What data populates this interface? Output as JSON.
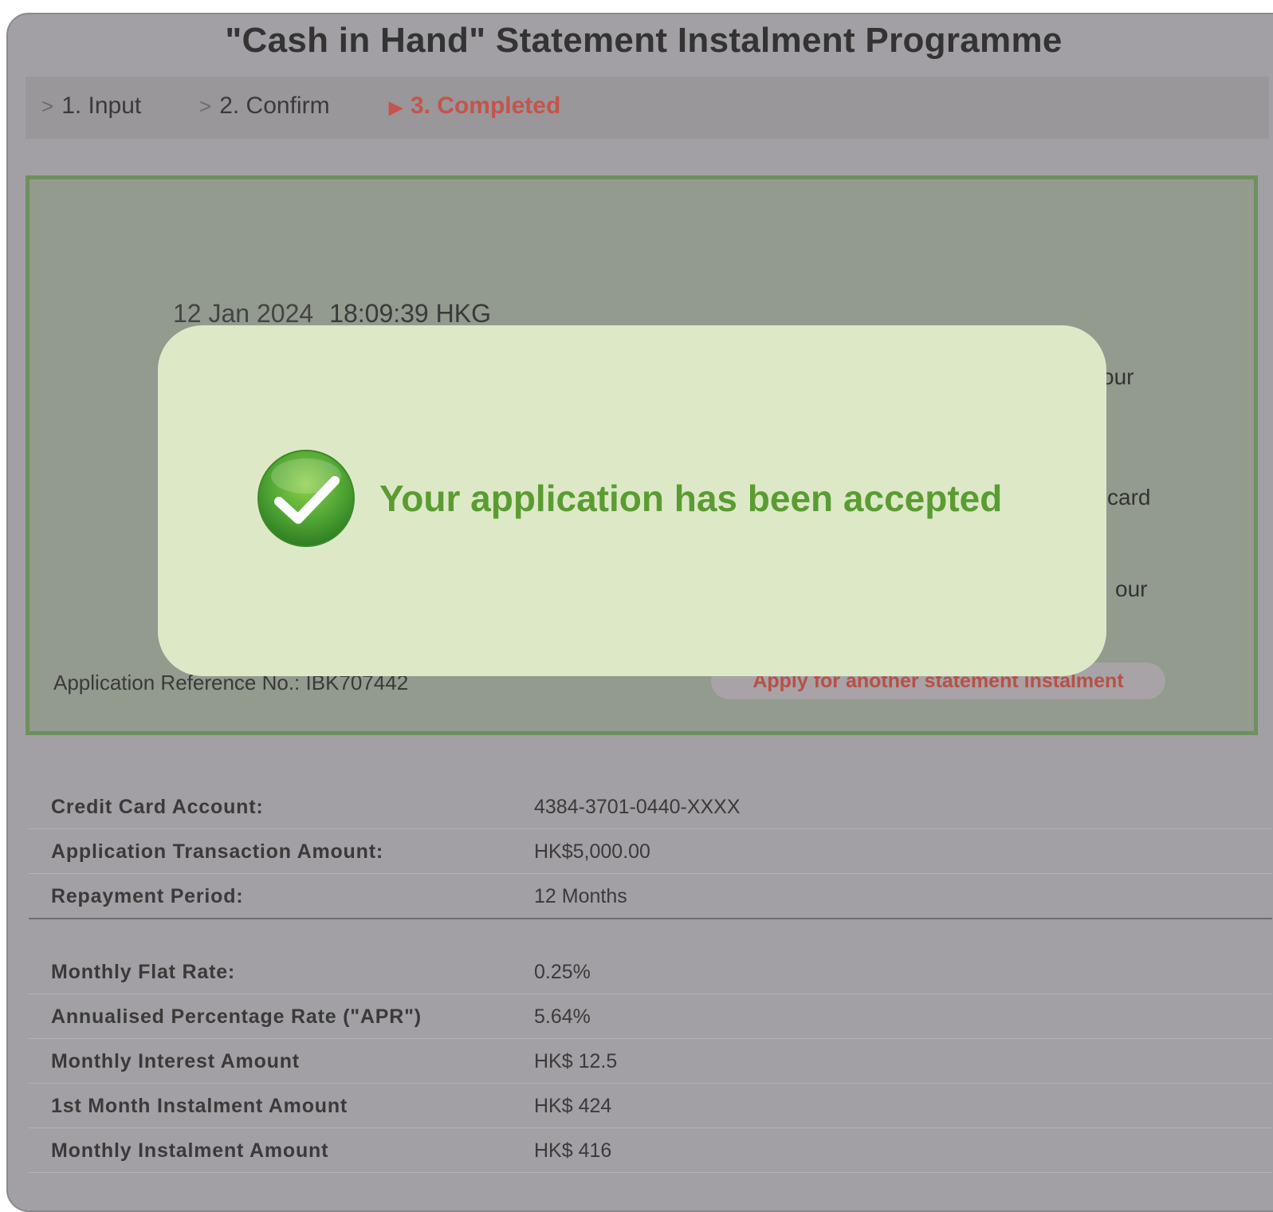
{
  "page": {
    "title": "\"Cash in Hand\" Statement Instalment Programme"
  },
  "steps": [
    {
      "label": "1. Input",
      "active": false
    },
    {
      "label": "2. Confirm",
      "active": false
    },
    {
      "label": "3. Completed",
      "active": true
    }
  ],
  "result": {
    "date": "12 Jan 2024",
    "time": "18:09:39 HKG",
    "peek_1": "our",
    "peek_2": "card",
    "peek_3": "our",
    "reference_text": "Application Reference No.: IBK707442",
    "apply_again_label": "Apply for another statement instalment"
  },
  "modal": {
    "message": "Your application has been accepted",
    "icon": "checkmark-circle-icon"
  },
  "details": {
    "group1": [
      {
        "label": "Credit Card Account:",
        "value": "4384-3701-0440-XXXX"
      },
      {
        "label": "Application Transaction Amount:",
        "value": "HK$5,000.00"
      },
      {
        "label": "Repayment Period:",
        "value": "12 Months"
      }
    ],
    "group2": [
      {
        "label": "Monthly Flat Rate:",
        "value": "0.25%"
      },
      {
        "label": "Annualised Percentage Rate (\"APR\")",
        "value": "5.64%"
      },
      {
        "label": "Monthly Interest Amount",
        "value": "HK$ 12.5"
      },
      {
        "label": "1st Month Instalment Amount",
        "value": "HK$ 424"
      },
      {
        "label": "Monthly Instalment Amount",
        "value": "HK$ 416"
      }
    ]
  },
  "colors": {
    "accent_red": "#c4544c",
    "success_green": "#5a9c32",
    "modal_bg": "#dde9c6"
  }
}
